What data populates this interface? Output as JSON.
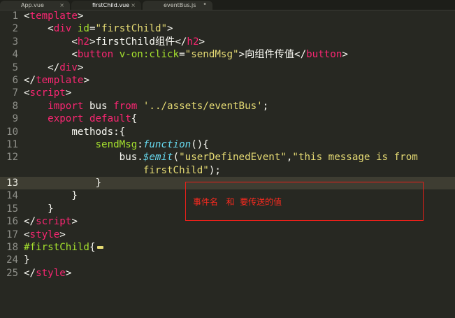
{
  "tabs": [
    {
      "label": "App.vue",
      "close": "×",
      "active": false
    },
    {
      "label": "firstChild.vue",
      "close": "×",
      "active": true
    },
    {
      "label": "eventBus.js",
      "close": "•",
      "active": false
    }
  ],
  "gutter": [
    "1",
    "2",
    "3",
    "4",
    "5",
    "6",
    "7",
    "8",
    "9",
    "10",
    "11",
    "12",
    "",
    "13",
    "14",
    "15",
    "16",
    "17",
    "18",
    "24",
    "25"
  ],
  "code": {
    "l1": {
      "open": "<",
      "tag": "template",
      "close": ">"
    },
    "l2": {
      "indent": "    ",
      "open": "<",
      "tag": "div",
      "sp": " ",
      "attr": "id",
      "eq": "=",
      "val": "\"firstChild\"",
      "close": ">"
    },
    "l3": {
      "indent": "        ",
      "open": "<",
      "tag": "h2",
      "close": ">",
      "text": "firstChild组件",
      "eopen": "</",
      "etag": "h2",
      "eclose": ">"
    },
    "l4": {
      "indent": "        ",
      "open": "<",
      "tag": "button",
      "sp": " ",
      "attr": "v-on:click",
      "eq": "=",
      "val": "\"sendMsg\"",
      "close": ">",
      "text": "向组件传值",
      "eopen": "</",
      "etag": "button",
      "eclose": ">"
    },
    "l5": {
      "indent": "    ",
      "open": "</",
      "tag": "div",
      "close": ">"
    },
    "l6": {
      "open": "</",
      "tag": "template",
      "close": ">"
    },
    "l7": {
      "open": "<",
      "tag": "script",
      "close": ">"
    },
    "l8": {
      "indent": "    ",
      "kw": "import",
      "mid": " bus ",
      "kw2": "from",
      "sp": " ",
      "str": "'../assets/eventBus'",
      "end": ";"
    },
    "l9": {
      "indent": "    ",
      "kw": "export",
      "sp": " ",
      "kw2": "default",
      "end": "{"
    },
    "l10": {
      "indent": "        ",
      "text": "methods:{"
    },
    "l11": {
      "indent": "            ",
      "fn": "sendMsg",
      "colon": ":",
      "type": "function",
      "end": "(){"
    },
    "l12": {
      "indent": "                ",
      "obj": "bus.",
      "kw": "$emit",
      "p1": "(",
      "str1": "\"userDefinedEvent\"",
      "comma": ",",
      "str2": "\"this message is from"
    },
    "l12b": {
      "indent": "                    ",
      "str": "firstChild\"",
      "end": ");"
    },
    "l13": {
      "indent": "            ",
      "text": "}"
    },
    "l14": {
      "indent": "        ",
      "text": "}"
    },
    "l15": {
      "indent": "    ",
      "text": "}"
    },
    "l16": {
      "open": "</",
      "tag": "script",
      "close": ">"
    },
    "l17": {
      "open": "<",
      "tag": "style",
      "close": ">"
    },
    "l18": {
      "sel": "#firstChild",
      "end": "{"
    },
    "l24": {
      "text": "}"
    },
    "l25": {
      "open": "</",
      "tag": "style",
      "close": ">"
    }
  },
  "annotation": {
    "text": "事件名   和  要传送的值"
  },
  "colors": {
    "background": "#272822",
    "tag": "#f92672",
    "string": "#e6db74",
    "attr": "#a6e22e",
    "type": "#66d9ef",
    "annotation": "#e8201a"
  }
}
